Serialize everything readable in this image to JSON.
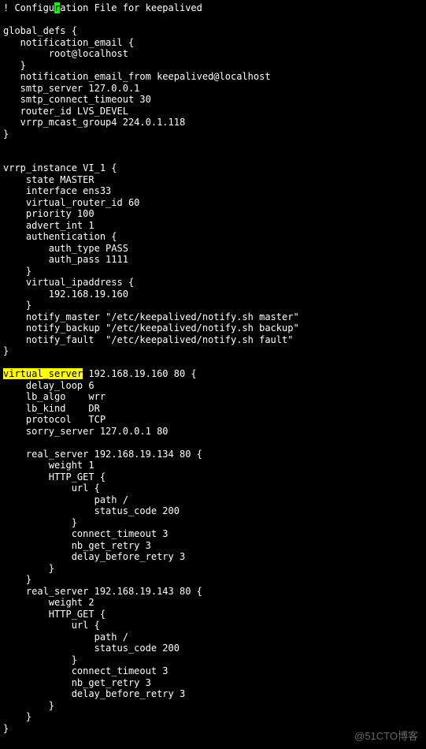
{
  "comment_prefix": "! Configu",
  "cursor_char": "r",
  "comment_suffix": "ation File for keepalived",
  "global_defs": {
    "open": "global_defs {",
    "notification_email_open": "   notification_email {",
    "notification_email_value": "        root@localhost",
    "notification_email_close": "   }",
    "from": "   notification_email_from keepalived@localhost",
    "smtp_server": "   smtp_server 127.0.0.1",
    "smtp_timeout": "   smtp_connect_timeout 30",
    "router_id": "   router_id LVS_DEVEL",
    "vrrp_mcast": "   vrrp_mcast_group4 224.0.1.118",
    "close": "}"
  },
  "vrrp": {
    "open": "vrrp_instance VI_1 {",
    "state": "    state MASTER",
    "interface": "    interface ens33",
    "vrid": "    virtual_router_id 60",
    "priority": "    priority 100",
    "advert": "    advert_int 1",
    "auth_open": "    authentication {",
    "auth_type": "        auth_type PASS",
    "auth_pass": "        auth_pass 1111",
    "auth_close": "    }",
    "vip_open": "    virtual_ipaddress {",
    "vip_value": "        192.168.19.160",
    "vip_close": "    }",
    "notify_master": "    notify_master \"/etc/keepalived/notify.sh master\"",
    "notify_backup": "    notify_backup \"/etc/keepalived/notify.sh backup\"",
    "notify_fault": "    notify_fault  \"/etc/keepalived/notify.sh fault\"",
    "close": "}"
  },
  "vs": {
    "hl": "virtual_server",
    "open_rest": " 192.168.19.160 80 {",
    "delay_loop": "    delay_loop 6",
    "lb_algo": "    lb_algo    wrr",
    "lb_kind": "    lb_kind    DR",
    "protocol": "    protocol   TCP",
    "sorry": "    sorry_server 127.0.0.1 80",
    "rs1": {
      "open": "    real_server 192.168.19.134 80 {",
      "weight": "        weight 1",
      "http_open": "        HTTP_GET {",
      "url_open": "            url {",
      "path": "                path /",
      "status": "                status_code 200",
      "url_close": "            }",
      "connect_timeout": "            connect_timeout 3",
      "nb_get_retry": "            nb_get_retry 3",
      "delay_before_retry": "            delay_before_retry 3",
      "http_close": "        }",
      "close": "    }"
    },
    "rs2": {
      "open": "    real_server 192.168.19.143 80 {",
      "weight": "        weight 2",
      "http_open": "        HTTP_GET {",
      "url_open": "            url {",
      "path": "                path /",
      "status": "                status_code 200",
      "url_close": "            }",
      "connect_timeout": "            connect_timeout 3",
      "nb_get_retry": "            nb_get_retry 3",
      "delay_before_retry": "            delay_before_retry 3",
      "http_close": "        }",
      "close": "    }"
    },
    "close": "}"
  },
  "watermark": "@51CTO博客"
}
